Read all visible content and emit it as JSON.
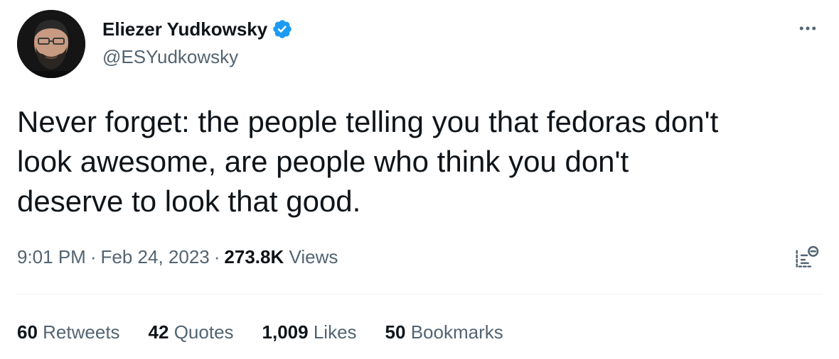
{
  "author": {
    "display_name": "Eliezer Yudkowsky",
    "handle": "@ESYudkowsky",
    "verified": true,
    "verified_color": "#1d9bf0",
    "avatar_icon": "profile-photo"
  },
  "tweet": {
    "text": "Never forget: the people telling you that fedoras don't\nlook awesome, are people who think you don't\ndeserve to look that good."
  },
  "meta": {
    "time": "9:01 PM",
    "separator": "·",
    "date": "Feb 24, 2023",
    "views_count": "273.8K",
    "views_label": "Views"
  },
  "stats": [
    {
      "count": "60",
      "label": "Retweets"
    },
    {
      "count": "42",
      "label": "Quotes"
    },
    {
      "count": "1,009",
      "label": "Likes"
    },
    {
      "count": "50",
      "label": "Bookmarks"
    }
  ],
  "icons": {
    "more": "more-horizontal-icon",
    "analytics": "analytics-icon"
  },
  "colors": {
    "text_primary": "#0f1419",
    "text_secondary": "#536471",
    "divider": "#eff3f4",
    "verified": "#1d9bf0"
  }
}
